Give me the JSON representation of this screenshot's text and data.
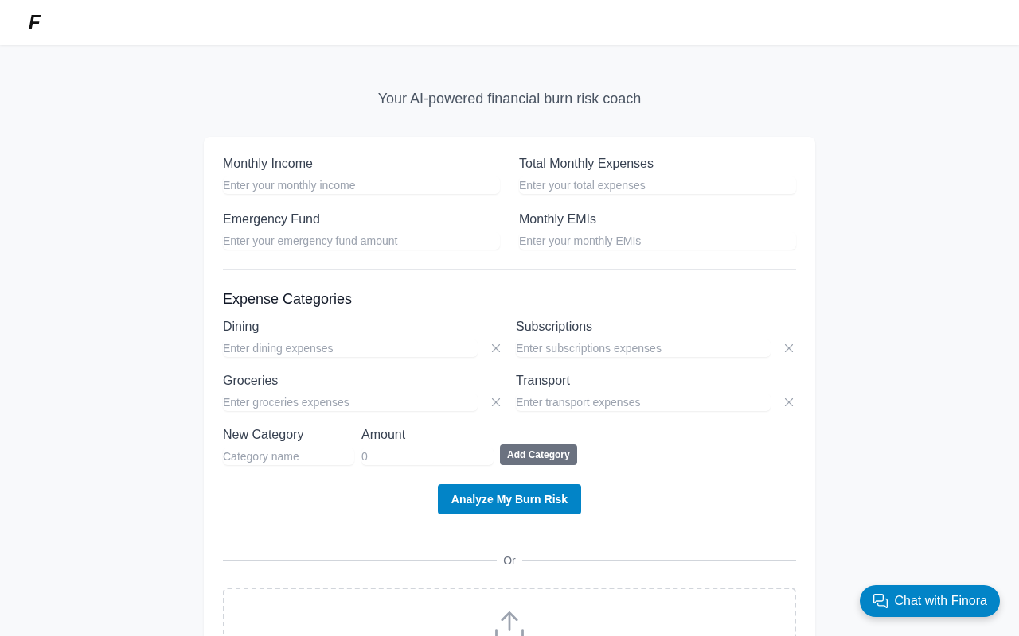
{
  "header": {
    "logo": "F"
  },
  "subtitle": "Your AI-powered financial burn risk coach",
  "fields": [
    {
      "label": "Monthly Income",
      "placeholder": "Enter your monthly income"
    },
    {
      "label": "Total Monthly Expenses",
      "placeholder": "Enter your total expenses"
    },
    {
      "label": "Emergency Fund",
      "placeholder": "Enter your emergency fund amount"
    },
    {
      "label": "Monthly EMIs",
      "placeholder": "Enter your monthly EMIs"
    }
  ],
  "expense_categories": {
    "title": "Expense Categories",
    "items": [
      {
        "label": "Dining",
        "placeholder": "Enter dining expenses"
      },
      {
        "label": "Subscriptions",
        "placeholder": "Enter subscriptions expenses"
      },
      {
        "label": "Groceries",
        "placeholder": "Enter groceries expenses"
      },
      {
        "label": "Transport",
        "placeholder": "Enter transport expenses"
      }
    ],
    "new_category": {
      "name_label": "New Category",
      "name_placeholder": "Category name",
      "amount_label": "Amount",
      "amount_placeholder": "0",
      "button": "Add Category"
    }
  },
  "analyze_button": "Analyze My Burn Risk",
  "divider": "Or",
  "chat_button": "Chat with Finora"
}
